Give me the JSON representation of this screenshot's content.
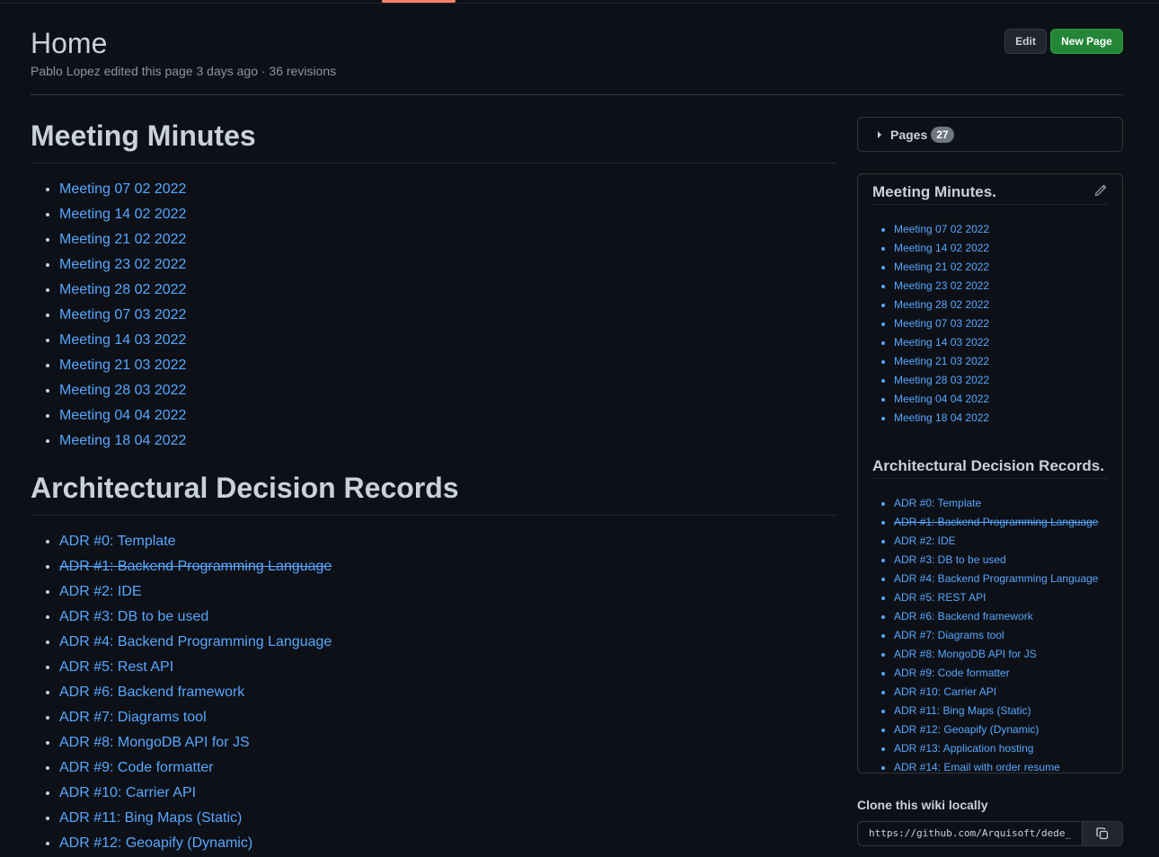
{
  "header": {
    "title": "Home",
    "author": "Pablo Lopez",
    "meta_rest": " edited this page 3 days ago · 36 revisions",
    "edit_label": "Edit",
    "new_page_label": "New Page"
  },
  "main": {
    "meeting_heading": "Meeting Minutes",
    "meetings": [
      "Meeting 07 02 2022",
      "Meeting 14 02 2022",
      "Meeting 21 02 2022",
      "Meeting 23 02 2022",
      "Meeting 28 02 2022",
      "Meeting 07 03 2022",
      "Meeting 14 03 2022",
      "Meeting 21 03 2022",
      "Meeting 28 03 2022",
      "Meeting 04 04 2022",
      "Meeting 18 04 2022"
    ],
    "adr_heading": "Architectural Decision Records",
    "adrs": [
      "ADR #0: Template",
      "ADR #1: Backend Programming Language",
      "ADR #2: IDE",
      "ADR #3: DB to be used",
      "ADR #4: Backend Programming Language",
      "ADR #5: Rest API",
      "ADR #6: Backend framework",
      "ADR #7: Diagrams tool",
      "ADR #8: MongoDB API for JS",
      "ADR #9: Code formatter",
      "ADR #10: Carrier API",
      "ADR #11: Bing Maps (Static)",
      "ADR #12: Geoapify (Dynamic)"
    ]
  },
  "sidebar": {
    "pages_label": "Pages",
    "pages_count": "27",
    "meeting_heading": "Meeting Minutes.",
    "meetings": [
      "Meeting 07 02 2022",
      "Meeting 14 02 2022",
      "Meeting 21 02 2022",
      "Meeting 23 02 2022",
      "Meeting 28 02 2022",
      "Meeting 07 03 2022",
      "Meeting 14 03 2022",
      "Meeting 21 03 2022",
      "Meeting 28 03 2022",
      "Meeting 04 04 2022",
      "Meeting 18 04 2022"
    ],
    "adr_heading": "Architectural Decision Records.",
    "adrs": [
      "ADR #0: Template",
      "ADR #1: Backend Programming Language",
      "ADR #2: IDE",
      "ADR #3: DB to be used",
      "ADR #4: Backend Programming Language",
      "ADR #5: REST API",
      "ADR #6: Backend framework",
      "ADR #7: Diagrams tool",
      "ADR #8: MongoDB API for JS",
      "ADR #9: Code formatter",
      "ADR #10: Carrier API",
      "ADR #11: Bing Maps (Static)",
      "ADR #12: Geoapify (Dynamic)",
      "ADR #13: Application hosting",
      "ADR #14: Email with order resume"
    ]
  },
  "clone": {
    "title": "Clone this wiki locally",
    "url": "https://github.com/Arquisoft/dede_"
  },
  "colors": {
    "link": "#58a6ff",
    "accent": "#f78166",
    "primary_button": "#238636"
  }
}
